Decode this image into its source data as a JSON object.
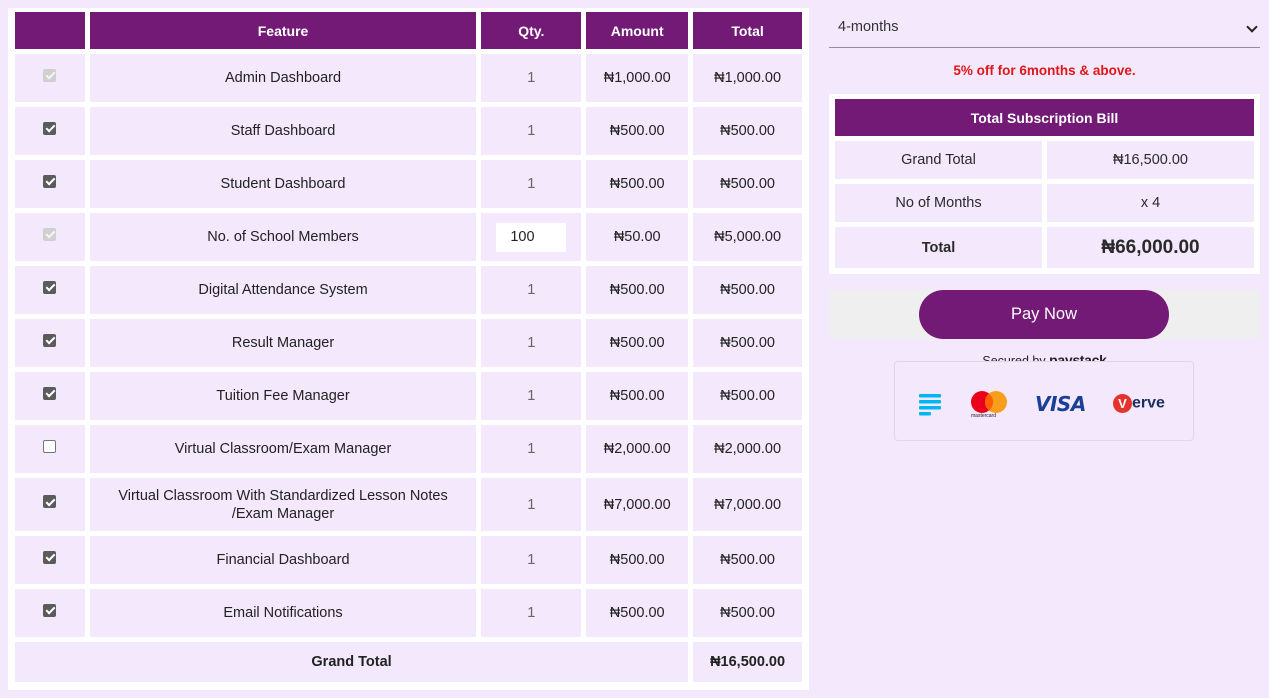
{
  "table": {
    "headers": {
      "check": "",
      "feature": "Feature",
      "qty": "Qty.",
      "amount": "Amount",
      "total": "Total"
    },
    "rows": [
      {
        "feature": "Admin Dashboard",
        "qty": "1",
        "amount": "₦1,000.00",
        "total": "₦1,000.00",
        "state": "disabled"
      },
      {
        "feature": "Staff Dashboard",
        "qty": "1",
        "amount": "₦500.00",
        "total": "₦500.00",
        "state": "checked"
      },
      {
        "feature": "Student Dashboard",
        "qty": "1",
        "amount": "₦500.00",
        "total": "₦500.00",
        "state": "checked"
      },
      {
        "feature": "No. of School Members",
        "qty": "100",
        "amount": "₦50.00",
        "total": "₦5,000.00",
        "state": "disabled"
      },
      {
        "feature": "Digital Attendance System",
        "qty": "1",
        "amount": "₦500.00",
        "total": "₦500.00",
        "state": "checked"
      },
      {
        "feature": "Result Manager",
        "qty": "1",
        "amount": "₦500.00",
        "total": "₦500.00",
        "state": "checked"
      },
      {
        "feature": "Tuition Fee Manager",
        "qty": "1",
        "amount": "₦500.00",
        "total": "₦500.00",
        "state": "checked"
      },
      {
        "feature": "Virtual Classroom/Exam Manager",
        "qty": "1",
        "amount": "₦2,000.00",
        "total": "₦2,000.00",
        "state": "unchecked"
      },
      {
        "feature": "Virtual Classroom With Standardized Lesson Notes /Exam Manager",
        "qty": "1",
        "amount": "₦7,000.00",
        "total": "₦7,000.00",
        "state": "checked"
      },
      {
        "feature": "Financial Dashboard",
        "qty": "1",
        "amount": "₦500.00",
        "total": "₦500.00",
        "state": "checked"
      },
      {
        "feature": "Email Notifications",
        "qty": "1",
        "amount": "₦500.00",
        "total": "₦500.00",
        "state": "checked"
      }
    ],
    "grand_total_label": "Grand Total",
    "grand_total_value": "₦16,500.00"
  },
  "period_select": {
    "selected": "4-months"
  },
  "discount_note": "5% off for 6months & above.",
  "bill": {
    "title": "Total Subscription Bill",
    "grand_total_label": "Grand Total",
    "grand_total_value": "₦16,500.00",
    "months_label": "No of Months",
    "months_value": "x 4",
    "total_label": "Total",
    "total_value": "₦66,000.00"
  },
  "pay_button_label": "Pay Now",
  "secured": {
    "prefix": "Secured by",
    "brand": "paystack"
  },
  "card_logos": {
    "paystack": "paystack-stack-icon",
    "mastercard_text": "mastercard",
    "visa_text": "VISA",
    "verve_text": "erve",
    "verve_mark": "V"
  },
  "colors": {
    "header_purple": "#721a75",
    "page_bg": "#f3e8fc",
    "discount_red": "#e0161a"
  }
}
